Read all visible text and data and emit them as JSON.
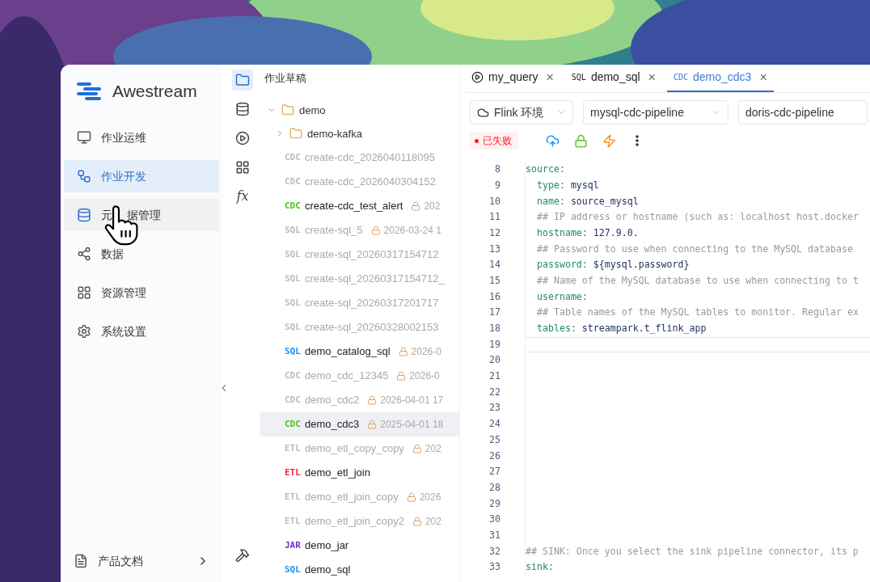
{
  "app": {
    "name": "Awestream"
  },
  "nav": [
    {
      "label_parts": [
        "作业运维"
      ],
      "selected": false,
      "hovered": false
    },
    {
      "label_parts": [
        "作业开发"
      ],
      "selected": true,
      "hovered": false
    },
    {
      "label_parts": [
        "元",
        "据管理"
      ],
      "selected": false,
      "hovered": true
    },
    {
      "label_parts": [
        "数据"
      ],
      "selected": false,
      "hovered": false
    },
    {
      "label_parts": [
        "资源管理"
      ],
      "selected": false,
      "hovered": false
    },
    {
      "label_parts": [
        "系统设置"
      ],
      "selected": false,
      "hovered": false
    }
  ],
  "nav_footer": {
    "label": "产品文档"
  },
  "rail": [
    {
      "kind": "folder",
      "selected": true
    },
    {
      "kind": "database",
      "selected": false
    },
    {
      "kind": "play",
      "selected": false
    },
    {
      "kind": "grid",
      "selected": false
    },
    {
      "kind": "text",
      "text": "fx",
      "selected": false
    },
    {
      "kind": "hammer",
      "selected": false
    }
  ],
  "tree": {
    "title": "作业草稿",
    "folders": [
      {
        "name": "demo",
        "expanded": true
      },
      {
        "name": "demo-kafka",
        "expanded": false
      }
    ],
    "items": [
      {
        "tag": "CDC",
        "color": "#b8bcc4",
        "name": "create-cdc_2026040118095",
        "dim": true,
        "selected": false
      },
      {
        "tag": "CDC",
        "color": "#b8bcc4",
        "name": "create-cdc_2026040304152",
        "dim": true,
        "selected": false
      },
      {
        "tag": "CDC",
        "color": "#52c41a",
        "name": "create-cdc_test_alert",
        "dim": false,
        "lock": true,
        "date": "202",
        "selected": false
      },
      {
        "tag": "SQL",
        "color": "#b8bcc4",
        "name": "create-sql_5",
        "dim": true,
        "lock": true,
        "date": "2026-03-24 1",
        "selected": false
      },
      {
        "tag": "SQL",
        "color": "#b8bcc4",
        "name": "create-sql_20260317154712",
        "dim": true,
        "selected": false
      },
      {
        "tag": "SQL",
        "color": "#b8bcc4",
        "name": "create-sql_20260317154712_",
        "dim": true,
        "selected": false
      },
      {
        "tag": "SQL",
        "color": "#b8bcc4",
        "name": "create-sql_20260317201717",
        "dim": true,
        "selected": false
      },
      {
        "tag": "SQL",
        "color": "#b8bcc4",
        "name": "create-sql_20260328002153",
        "dim": true,
        "selected": false
      },
      {
        "tag": "SQL",
        "color": "#1890ff",
        "name": "demo_catalog_sql",
        "dim": false,
        "lock": true,
        "date": "2026-0",
        "selected": false
      },
      {
        "tag": "CDC",
        "color": "#b8bcc4",
        "name": "demo_cdc_12345",
        "dim": true,
        "lock": true,
        "date": "2026-0",
        "selected": false
      },
      {
        "tag": "CDC",
        "color": "#b8bcc4",
        "name": "demo_cdc2",
        "dim": true,
        "lock": true,
        "date": "2026-04-01 17",
        "selected": false
      },
      {
        "tag": "CDC",
        "color": "#52c41a",
        "name": "demo_cdc3",
        "dim": false,
        "lock": true,
        "date": "2025-04-01 18",
        "selected": true
      },
      {
        "tag": "ETL",
        "color": "#b8bcc4",
        "name": "demo_etl_copy_copy",
        "dim": true,
        "lock": true,
        "date": "202",
        "selected": false
      },
      {
        "tag": "ETL",
        "color": "#f5222d",
        "name": "demo_etl_join",
        "dim": false,
        "selected": false
      },
      {
        "tag": "ETL",
        "color": "#b8bcc4",
        "name": "demo_etl_join_copy",
        "dim": true,
        "lock": true,
        "date": "2026",
        "selected": false
      },
      {
        "tag": "ETL",
        "color": "#b8bcc4",
        "name": "demo_etl_join_copy2",
        "dim": true,
        "lock": true,
        "date": "202",
        "selected": false
      },
      {
        "tag": "JAR",
        "color": "#722ed1",
        "name": "demo_jar",
        "dim": false,
        "selected": false
      },
      {
        "tag": "SQL",
        "color": "#1890ff",
        "name": "demo_sql",
        "dim": false,
        "selected": false
      }
    ]
  },
  "tabs": [
    {
      "kind": "play",
      "label": "my_query",
      "close": "×",
      "selected": false
    },
    {
      "kind": "tag",
      "tag": "SQL",
      "label": "demo_sql",
      "close": "×",
      "selected": false
    },
    {
      "kind": "tag",
      "tag": "CDC",
      "label": "demo_cdc3",
      "close": "×",
      "selected": true
    }
  ],
  "toolbar": {
    "selects": [
      {
        "label": "Flink 环境",
        "icon": true,
        "caret": true
      },
      {
        "label": "mysql-cdc-pipeline",
        "icon": false,
        "caret": true
      },
      {
        "label": "doris-cdc-pipeline",
        "icon": false,
        "caret": false
      }
    ],
    "status": {
      "label": "已失败",
      "color": "#f5222d"
    },
    "actions": [
      {
        "kind": "upload",
        "color": "#1890ff"
      },
      {
        "kind": "lock",
        "color": "#52c41a"
      },
      {
        "kind": "bolt",
        "color": "#fa8c16"
      },
      {
        "kind": "more",
        "color": "#333333"
      }
    ]
  },
  "editor": {
    "lines": [
      {
        "no": "8",
        "kind": "pair",
        "indented": false,
        "key": "source:"
      },
      {
        "no": "9",
        "kind": "pair",
        "indented": true,
        "key": "type:",
        "value": "mysql"
      },
      {
        "no": "10",
        "kind": "pair",
        "indented": true,
        "key": "name:",
        "value": "source_mysql"
      },
      {
        "no": "11",
        "kind": "comment",
        "indented": true,
        "text": "## IP address or hostname (such as: localhost host.docker"
      },
      {
        "no": "12",
        "kind": "pair",
        "indented": true,
        "key": "hostname:",
        "value": "127.9.0."
      },
      {
        "no": "13",
        "kind": "comment",
        "indented": true,
        "text": "## Password to use when connecting to the MySQL database "
      },
      {
        "no": "14",
        "kind": "pair",
        "indented": true,
        "key": "password:",
        "value": "${mysql.password}"
      },
      {
        "no": "15",
        "kind": "comment",
        "indented": true,
        "text": "## Name of the MySQL database to use when connecting to t"
      },
      {
        "no": "16",
        "kind": "pair",
        "indented": true,
        "key": "username:"
      },
      {
        "no": "17",
        "kind": "comment",
        "indented": true,
        "text": "## Table names of the MySQL tables to monitor. Regular ex"
      },
      {
        "no": "18",
        "kind": "pair",
        "indented": true,
        "key": "tables:",
        "value": "streampark.t_flink_app"
      },
      {
        "no": "19",
        "kind": "empty",
        "current": true
      },
      {
        "no": "20",
        "kind": "empty"
      },
      {
        "no": "21",
        "kind": "empty"
      },
      {
        "no": "22",
        "kind": "empty"
      },
      {
        "no": "23",
        "kind": "empty"
      },
      {
        "no": "24",
        "kind": "empty"
      },
      {
        "no": "25",
        "kind": "empty"
      },
      {
        "no": "26",
        "kind": "empty"
      },
      {
        "no": "27",
        "kind": "empty"
      },
      {
        "no": "28",
        "kind": "empty"
      },
      {
        "no": "29",
        "kind": "empty"
      },
      {
        "no": "30",
        "kind": "empty"
      },
      {
        "no": "31",
        "kind": "empty"
      },
      {
        "no": "32",
        "kind": "comment",
        "indented": false,
        "text": "## SINK: Once you select the sink pipeline connector, its p"
      },
      {
        "no": "33",
        "kind": "pair",
        "indented": false,
        "key": "sink:"
      }
    ]
  }
}
